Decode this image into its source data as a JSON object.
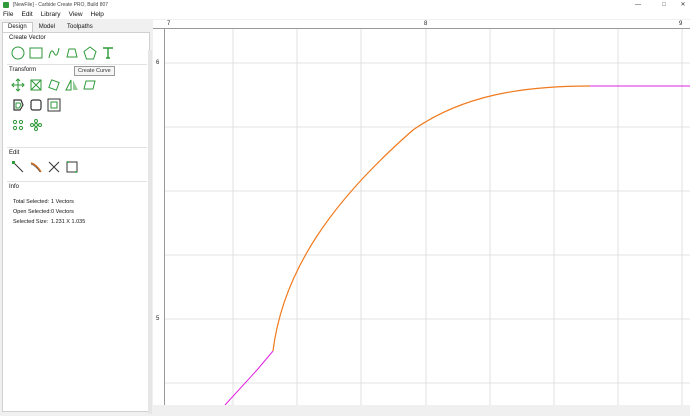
{
  "window": {
    "title": "[NewFile] - Carbide Create PRO, Build 807"
  },
  "menu": [
    "File",
    "Edit",
    "Library",
    "View",
    "Help"
  ],
  "tabs": [
    "Design",
    "Model",
    "Toolpaths"
  ],
  "sections": {
    "create_vector": "Create Vector",
    "transform": "Transform",
    "edit": "Edit",
    "info": "Info"
  },
  "tooltip": "Create Curve",
  "info": {
    "rows": [
      {
        "label": "Total Selected:",
        "value": "1 Vectors"
      },
      {
        "label": "Open Selected:",
        "value": "0 Vectors"
      },
      {
        "label": "Selected Size:",
        "value": "1.231 X 1.035"
      }
    ]
  },
  "rulers": {
    "top": [
      "7",
      "8",
      "9"
    ],
    "left": [
      "6",
      "5"
    ]
  },
  "colors": {
    "tool_green": "#2e9a3a",
    "curve_orange": "#f07a1e",
    "curve_magenta": "#e020e0",
    "grid": "#d8d8d8"
  }
}
